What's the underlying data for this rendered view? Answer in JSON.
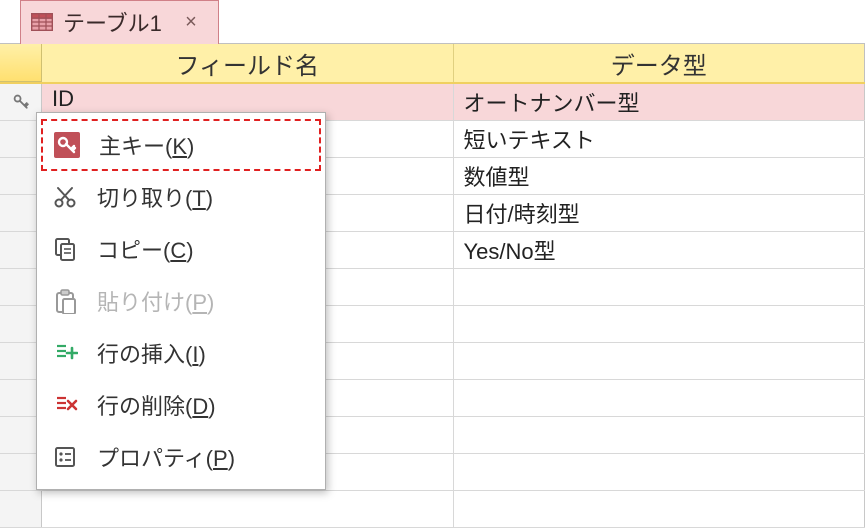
{
  "tab": {
    "title": "テーブル1",
    "icon": "table-icon",
    "close": "×"
  },
  "columns": {
    "field_name": "フィールド名",
    "data_type": "データ型"
  },
  "rows": [
    {
      "field": "ID",
      "type": "オートナンバー型",
      "active": true,
      "pk": true
    },
    {
      "field": "",
      "type": "短いテキスト"
    },
    {
      "field": "",
      "type": "数値型"
    },
    {
      "field": "",
      "type": "日付/時刻型"
    },
    {
      "field": "",
      "type": "Yes/No型"
    },
    {
      "field": "",
      "type": ""
    },
    {
      "field": "",
      "type": ""
    },
    {
      "field": "",
      "type": ""
    },
    {
      "field": "",
      "type": ""
    },
    {
      "field": "",
      "type": ""
    },
    {
      "field": "",
      "type": ""
    },
    {
      "field": "",
      "type": ""
    }
  ],
  "context_menu": [
    {
      "id": "primary-key",
      "label": "主キー",
      "hotkey": "K",
      "icon": "key-icon",
      "enabled": true,
      "highlight": true
    },
    {
      "id": "cut",
      "label": "切り取り",
      "hotkey": "T",
      "icon": "scissors-icon",
      "enabled": true
    },
    {
      "id": "copy",
      "label": "コピー",
      "hotkey": "C",
      "icon": "copy-icon",
      "enabled": true
    },
    {
      "id": "paste",
      "label": "貼り付け",
      "hotkey": "P",
      "icon": "paste-icon",
      "enabled": false
    },
    {
      "id": "insert-rows",
      "label": "行の挿入",
      "hotkey": "I",
      "icon": "insert-row-icon",
      "enabled": true
    },
    {
      "id": "delete-rows",
      "label": "行の削除",
      "hotkey": "D",
      "icon": "delete-row-icon",
      "enabled": true
    },
    {
      "id": "properties",
      "label": "プロパティ",
      "hotkey": "P",
      "icon": "properties-icon",
      "enabled": true
    }
  ]
}
